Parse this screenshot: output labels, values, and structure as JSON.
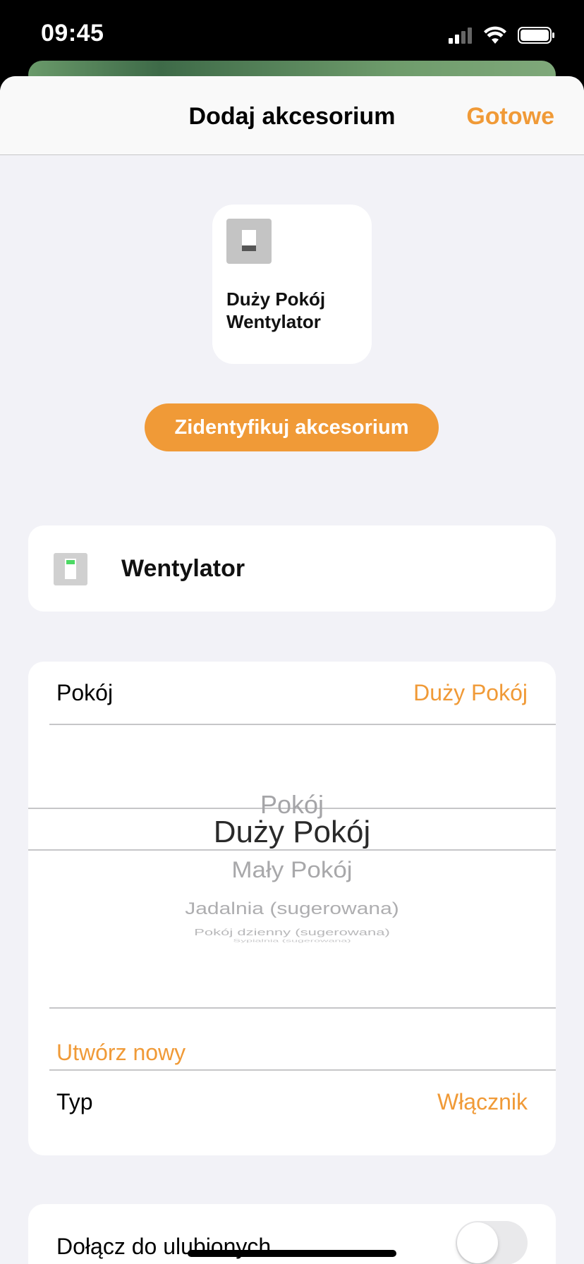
{
  "status_bar": {
    "time": "09:45"
  },
  "nav": {
    "title": "Dodaj akcesorium",
    "done_label": "Gotowe"
  },
  "tile": {
    "name_line1": "Duży Pokój",
    "name_line2": "Wentylator"
  },
  "identify_button": "Zidentyfikuj akcesorium",
  "accessory": {
    "name": "Wentylator"
  },
  "room": {
    "label": "Pokój",
    "value": "Duży Pokój",
    "picker_items": [
      "Pokój",
      "Duży Pokój",
      "Mały Pokój",
      "Jadalnia (sugerowana)",
      "Pokój dzienny (sugerowana)",
      "Sypialnia (sugerowana)"
    ],
    "create_new": "Utwórz nowy"
  },
  "type": {
    "label": "Typ",
    "value": "Włącznik"
  },
  "favorites": {
    "label": "Dołącz do ulubionych",
    "on": false
  },
  "colors": {
    "accent": "#f09a37",
    "background": "#f2f2f7"
  }
}
